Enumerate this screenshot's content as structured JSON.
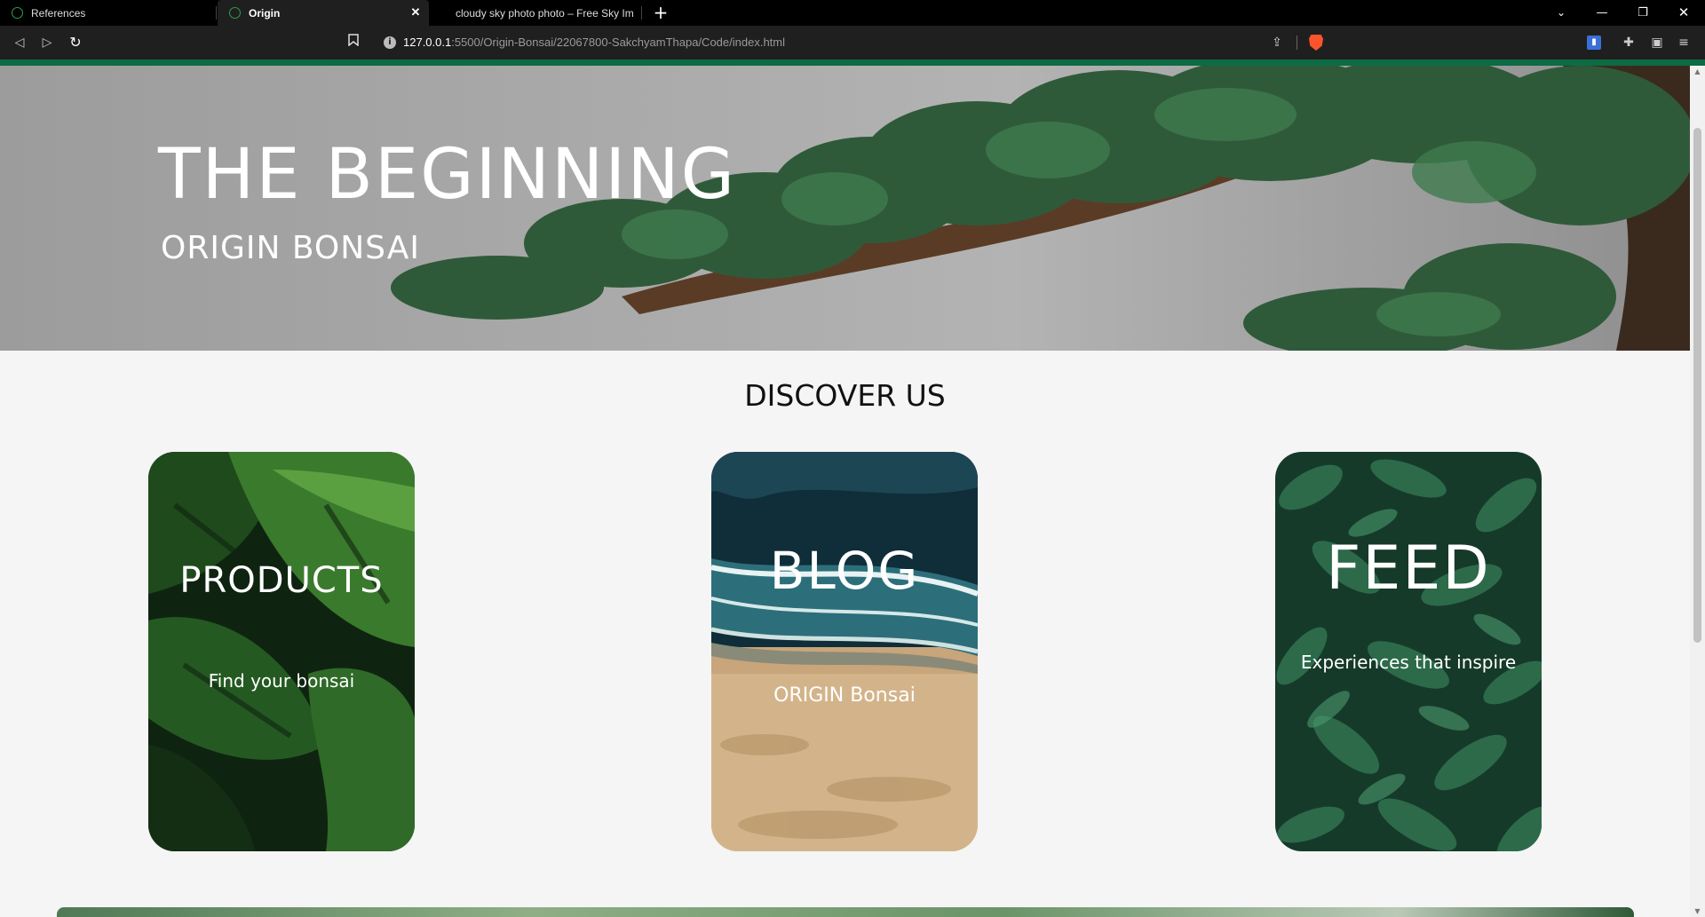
{
  "browser": {
    "tabs": [
      {
        "label": "References",
        "active": false
      },
      {
        "label": "Origin",
        "active": true
      },
      {
        "label": "cloudy sky photo photo – Free Sky Im",
        "active": false
      }
    ],
    "url_host": "127.0.0.1",
    "url_rest": ":5500/Origin-Bonsai/22067800-SakchyamThapa/Code/index.html",
    "accent_color": "#0d6b43"
  },
  "hero": {
    "title": "THE BEGINNING",
    "subtitle": "ORIGIN BONSAI"
  },
  "discover": {
    "title": "DISCOVER US",
    "cards": [
      {
        "title": "PRODUCTS",
        "subtitle": "Find your bonsai"
      },
      {
        "title": "BLOG",
        "subtitle": "ORIGIN Bonsai"
      },
      {
        "title": "FEED",
        "subtitle": "Experiences that inspire"
      }
    ]
  }
}
